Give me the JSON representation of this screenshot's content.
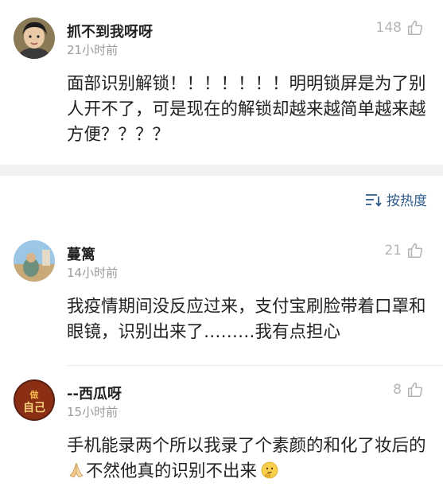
{
  "comments": [
    {
      "username": "抓不到我呀呀",
      "time": "21小时前",
      "likes": "148",
      "text": "面部识别解锁！！！！！！！明明锁屏是为了别人开不了，可是现在的解锁却越来越简单越来越方便？？？？"
    },
    {
      "username": "蔓篱",
      "time": "14小时前",
      "likes": "21",
      "text": "我疫情期间没反应过来，支付宝刷脸带着口罩和眼镜，识别出来了………我有点担心"
    },
    {
      "username": "--西瓜呀",
      "time": "15小时前",
      "likes": "8",
      "text_part1": "手机能录两个所以我录了个素颜的和化了妆后的",
      "text_part2": "不然他真的识别不出来",
      "emoji1": "praying-hands-emoji",
      "emoji2": "thinking-face-emoji"
    }
  ],
  "sort": {
    "label": "按热度",
    "icon": "sort-icon"
  },
  "colors": {
    "link_blue": "#2f5b8c",
    "muted_gray": "#9b9b9b",
    "divider": "#f1f1f1"
  }
}
